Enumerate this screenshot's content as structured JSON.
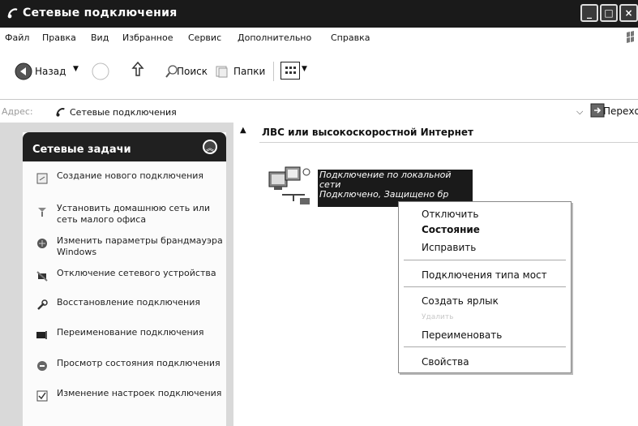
{
  "window": {
    "title": "Сетевые подключения"
  },
  "menu": [
    "Файл",
    "Правка",
    "Вид",
    "Избранное",
    "Сервис",
    "Дополнительно",
    "Справка"
  ],
  "toolbar": {
    "back": "Назад",
    "search": "Поиск",
    "folders": "Папки"
  },
  "address": {
    "label": "Адрес:",
    "value": "Сетевые подключения",
    "go": "Переход"
  },
  "tasks": {
    "title": "Сетевые задачи",
    "items": [
      {
        "label": "Создание нового подключения",
        "icon": "new-connection-icon"
      },
      {
        "label": "Установить домашнюю сеть или сеть малого офиса",
        "icon": "home-network-icon"
      },
      {
        "label": "Изменить параметры брандмауэра Windows",
        "icon": "firewall-icon"
      },
      {
        "label": "Отключение сетевого устройства",
        "icon": "disable-device-icon"
      },
      {
        "label": "Восстановление подключения",
        "icon": "repair-icon"
      },
      {
        "label": "Переименование подключения",
        "icon": "rename-icon"
      },
      {
        "label": "Просмотр состояния подключения",
        "icon": "status-icon"
      },
      {
        "label": "Изменение настроек подключения",
        "icon": "settings-icon"
      }
    ]
  },
  "group": {
    "title": "ЛВС или высокоскоростной Интернет"
  },
  "connection": {
    "name_line1": "Подключение по локальной",
    "name_line2": "сети",
    "status": "Подключено, Защищено бр"
  },
  "context_menu": {
    "items": [
      {
        "label": "Отключить",
        "bold": false,
        "disabled": false
      },
      {
        "label": "Состояние",
        "bold": true,
        "disabled": false
      },
      {
        "label": "Исправить",
        "bold": false,
        "disabled": false
      },
      {
        "label": "Подключения типа мост",
        "bold": false,
        "disabled": false
      },
      {
        "label": "Создать ярлык",
        "bold": false,
        "disabled": false
      },
      {
        "label": "Удалить",
        "bold": false,
        "disabled": true
      },
      {
        "label": "Переименовать",
        "bold": false,
        "disabled": false
      },
      {
        "label": "Свойства",
        "bold": false,
        "disabled": false
      }
    ]
  }
}
